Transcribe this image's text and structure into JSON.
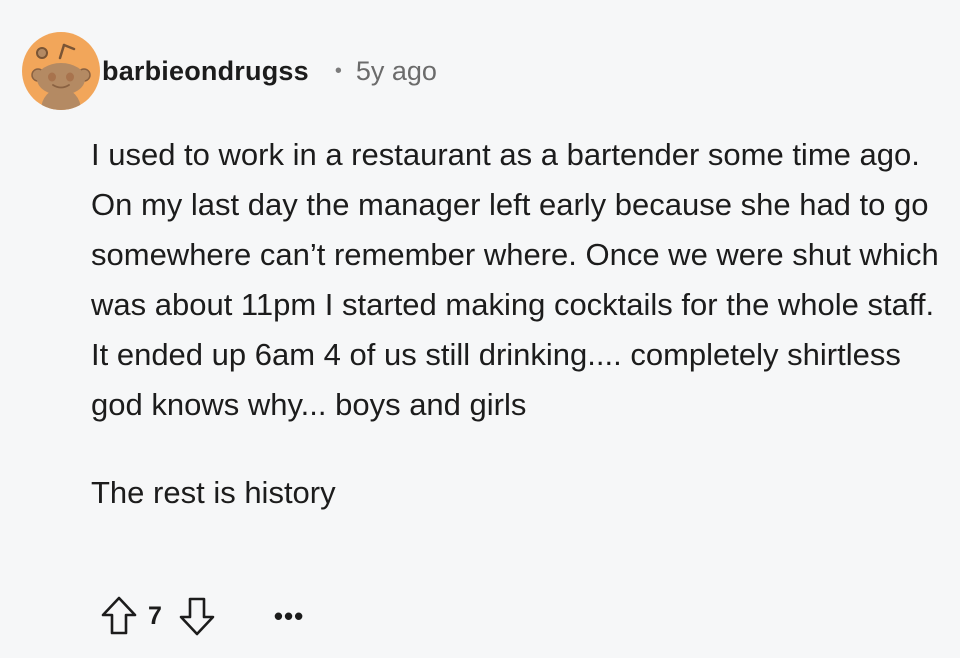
{
  "comment": {
    "author": "barbieondrugss",
    "separator": "•",
    "timestamp": "5y ago",
    "paragraphs": [
      "I used to work in a restaurant as a bartender some time ago. On my last day the manager left early because she had to go somewhere can’t remember where. Once we were shut which was about 11pm I started making cocktails for the whole staff. It ended up 6am 4 of us still drinking.... completely shirtless god knows why... boys and girls",
      "The rest is history"
    ],
    "score": "7",
    "more_label": "•••"
  },
  "icons": {
    "avatar": "snoo-avatar-icon",
    "upvote": "arrow-up-outline-icon",
    "downvote": "arrow-down-outline-icon",
    "more": "ellipsis-icon"
  },
  "colors": {
    "background": "#f6f7f8",
    "avatar_bg": "#f2a65a",
    "text": "#1c1c1c",
    "meta": "#6b6b6b"
  }
}
